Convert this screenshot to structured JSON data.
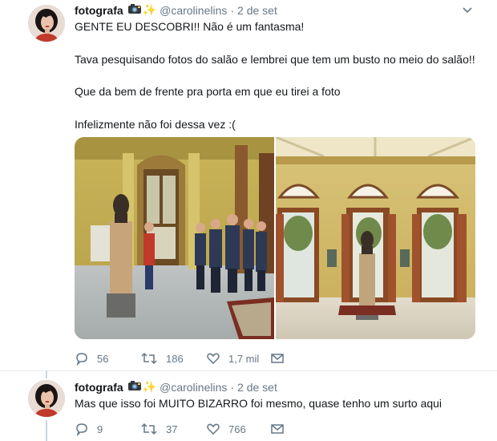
{
  "tweets": [
    {
      "author_name": "fotografa",
      "handle": "@carolinelins",
      "separator": "·",
      "date": "2 de set",
      "lines": [
        "GENTE EU DESCOBRI!! Não é um fantasma!",
        "Tava pesquisando fotos do salão e lembrei que tem um busto no meio do salão!!",
        "Que da bem de frente pra porta em que eu tirei a foto",
        "Infelizmente não foi dessa vez :("
      ],
      "replies": "56",
      "retweets": "186",
      "likes": "1,7 mil"
    },
    {
      "author_name": "fotografa",
      "handle": "@carolinelins",
      "separator": "·",
      "date": "2 de set",
      "lines": [
        "Mas que isso foi MUITO BIZARRO foi mesmo, quase tenho um surto aqui"
      ],
      "replies": "9",
      "retweets": "37",
      "likes": "766"
    }
  ],
  "icons": {
    "camera": "camera-with-flash-icon",
    "sparkles": "sparkles-icon",
    "reply": "reply-icon",
    "retweet": "retweet-icon",
    "like": "heart-icon",
    "dm": "envelope-icon",
    "menu": "chevron-down-icon"
  },
  "colors": {
    "text": "#14171a",
    "secondary": "#657786",
    "divider": "#e6ecf0"
  }
}
